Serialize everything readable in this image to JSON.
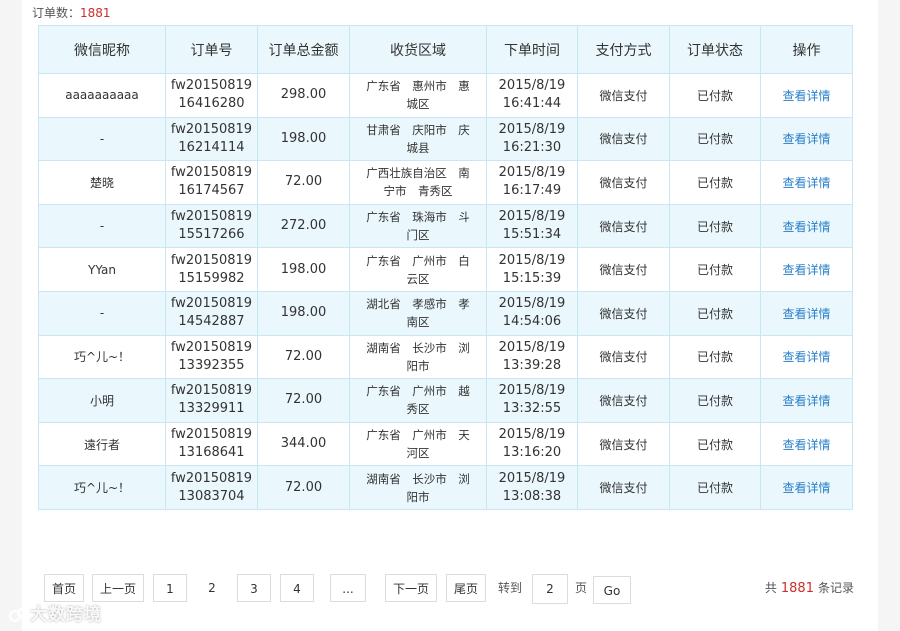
{
  "summary": {
    "label": "订单数：",
    "count": "1881"
  },
  "table": {
    "headers": [
      "微信昵称",
      "订单号",
      "订单总金额",
      "收货区域",
      "下单时间",
      "支付方式",
      "订单状态",
      "操作"
    ],
    "rows": [
      {
        "nickname": "aaaaaaaaaa",
        "order_no_1": "fw20150819",
        "order_no_2": "16416280",
        "amount": "298.00",
        "region_1": "广东省　惠州市　惠",
        "region_2": "城区",
        "date": "2015/8/19",
        "time": "16:41:44",
        "payment": "微信支付",
        "status": "已付款",
        "action": "查看详情"
      },
      {
        "nickname": "-",
        "order_no_1": "fw20150819",
        "order_no_2": "16214114",
        "amount": "198.00",
        "region_1": "甘肃省　庆阳市　庆",
        "region_2": "城县",
        "date": "2015/8/19",
        "time": "16:21:30",
        "payment": "微信支付",
        "status": "已付款",
        "action": "查看详情"
      },
      {
        "nickname": "楚晓",
        "order_no_1": "fw20150819",
        "order_no_2": "16174567",
        "amount": "72.00",
        "region_1": "广西壮族自治区　南",
        "region_2": "宁市　青秀区",
        "date": "2015/8/19",
        "time": "16:17:49",
        "payment": "微信支付",
        "status": "已付款",
        "action": "查看详情"
      },
      {
        "nickname": "-",
        "order_no_1": "fw20150819",
        "order_no_2": "15517266",
        "amount": "272.00",
        "region_1": "广东省　珠海市　斗",
        "region_2": "门区",
        "date": "2015/8/19",
        "time": "15:51:34",
        "payment": "微信支付",
        "status": "已付款",
        "action": "查看详情"
      },
      {
        "nickname": "YYan",
        "order_no_1": "fw20150819",
        "order_no_2": "15159982",
        "amount": "198.00",
        "region_1": "广东省　广州市　白",
        "region_2": "云区",
        "date": "2015/8/19",
        "time": "15:15:39",
        "payment": "微信支付",
        "status": "已付款",
        "action": "查看详情"
      },
      {
        "nickname": "-",
        "order_no_1": "fw20150819",
        "order_no_2": "14542887",
        "amount": "198.00",
        "region_1": "湖北省　孝感市　孝",
        "region_2": "南区",
        "date": "2015/8/19",
        "time": "14:54:06",
        "payment": "微信支付",
        "status": "已付款",
        "action": "查看详情"
      },
      {
        "nickname": "巧^儿~！",
        "order_no_1": "fw20150819",
        "order_no_2": "13392355",
        "amount": "72.00",
        "region_1": "湖南省　长沙市　浏",
        "region_2": "阳市",
        "date": "2015/8/19",
        "time": "13:39:28",
        "payment": "微信支付",
        "status": "已付款",
        "action": "查看详情"
      },
      {
        "nickname": "小明",
        "order_no_1": "fw20150819",
        "order_no_2": "13329911",
        "amount": "72.00",
        "region_1": "广东省　广州市　越",
        "region_2": "秀区",
        "date": "2015/8/19",
        "time": "13:32:55",
        "payment": "微信支付",
        "status": "已付款",
        "action": "查看详情"
      },
      {
        "nickname": "遠行者",
        "order_no_1": "fw20150819",
        "order_no_2": "13168641",
        "amount": "344.00",
        "region_1": "广东省　广州市　天",
        "region_2": "河区",
        "date": "2015/8/19",
        "time": "13:16:20",
        "payment": "微信支付",
        "status": "已付款",
        "action": "查看详情"
      },
      {
        "nickname": "巧^儿~！",
        "order_no_1": "fw20150819",
        "order_no_2": "13083704",
        "amount": "72.00",
        "region_1": "湖南省　长沙市　浏",
        "region_2": "阳市",
        "date": "2015/8/19",
        "time": "13:08:38",
        "payment": "微信支付",
        "status": "已付款",
        "action": "查看详情"
      }
    ]
  },
  "pagination": {
    "first": "首页",
    "prev": "上一页",
    "pages": [
      "1",
      "2",
      "3",
      "4"
    ],
    "current_page": "2",
    "ellipsis": "...",
    "next": "下一页",
    "last": "尾页",
    "goto_label": "转到",
    "goto_value": "2",
    "page_unit": "页",
    "go": "Go",
    "total_prefix": "共",
    "total_count": "1881",
    "total_suffix": "条记录"
  },
  "watermark": {
    "text": "大数跨境"
  }
}
